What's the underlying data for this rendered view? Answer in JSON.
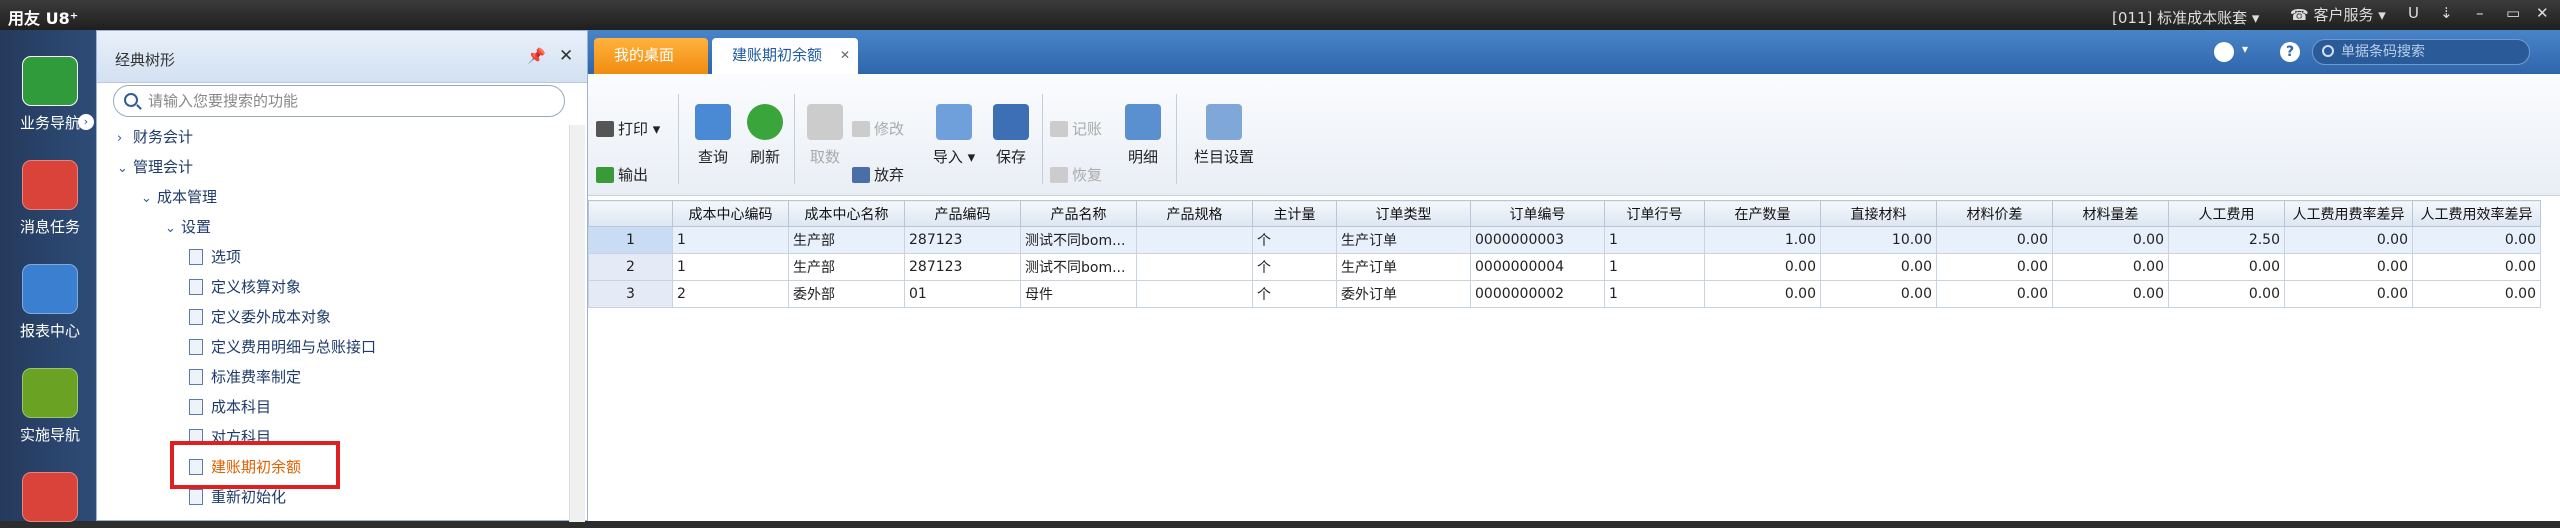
{
  "titlebar": {
    "app_title": "用友 U8⁺",
    "account": "[011] 标准成本账套",
    "service": "客户服务",
    "controls": [
      "U",
      "⇣",
      "–",
      "▭",
      "✕"
    ]
  },
  "leftnav": [
    {
      "label": "业务导航",
      "icon": "business-nav-icon",
      "color": "#2f9b3a"
    },
    {
      "label": "消息任务",
      "icon": "message-icon",
      "color": "#d9433a"
    },
    {
      "label": "报表中心",
      "icon": "report-icon",
      "color": "#3b7fd0"
    },
    {
      "label": "实施导航",
      "icon": "implement-icon",
      "color": "#6aa224"
    },
    {
      "label": "",
      "icon": "more-app-icon",
      "color": "#d9433a"
    }
  ],
  "tree": {
    "title": "经典树形",
    "search_placeholder": "请输入您要搜索的功能",
    "nodes": [
      {
        "label": "财务会计",
        "level": 0,
        "type": "collapsed"
      },
      {
        "label": "管理会计",
        "level": 0,
        "type": "expanded"
      },
      {
        "label": "成本管理",
        "level": 1,
        "type": "expanded"
      },
      {
        "label": "设置",
        "level": 2,
        "type": "expanded"
      },
      {
        "label": "选项",
        "level": 3,
        "type": "leaf"
      },
      {
        "label": "定义核算对象",
        "level": 3,
        "type": "leaf"
      },
      {
        "label": "定义委外成本对象",
        "level": 3,
        "type": "leaf"
      },
      {
        "label": "定义费用明细与总账接口",
        "level": 3,
        "type": "leaf"
      },
      {
        "label": "标准费率制定",
        "level": 3,
        "type": "leaf"
      },
      {
        "label": "成本科目",
        "level": 3,
        "type": "leaf"
      },
      {
        "label": "对方科目",
        "level": 3,
        "type": "leaf"
      },
      {
        "label": "建账期初余额",
        "level": 3,
        "type": "leaf",
        "active": true
      },
      {
        "label": "重新初始化",
        "level": 3,
        "type": "leaf"
      }
    ]
  },
  "tabs": {
    "desktop": "我的桌面",
    "balance": "建账期初余额",
    "close": "✕"
  },
  "barcode_placeholder": "单据条码搜索",
  "help": "?",
  "toolbar": {
    "print": "打印",
    "export": "输出",
    "query": "查询",
    "refresh": "刷新",
    "fetch": "取数",
    "modify": "修改",
    "abandon": "放弃",
    "import": "导入",
    "save": "保存",
    "post": "记账",
    "restore": "恢复",
    "detail": "明细",
    "column_settings": "栏目设置"
  },
  "table": {
    "columns": [
      "",
      "成本中心编码",
      "成本中心名称",
      "产品编码",
      "产品名称",
      "产品规格",
      "主计量",
      "订单类型",
      "订单编号",
      "订单行号",
      "在产数量",
      "直接材料",
      "材料价差",
      "材料量差",
      "人工费用",
      "人工费用费率差异",
      "人工费用效率差异"
    ],
    "rows": [
      [
        "1",
        "1",
        "生产部",
        "287123",
        "测试不同bom...",
        "",
        "个",
        "生产订单",
        "0000000003",
        "1",
        "1.00",
        "10.00",
        "0.00",
        "0.00",
        "2.50",
        "0.00",
        "0.00"
      ],
      [
        "2",
        "1",
        "生产部",
        "287123",
        "测试不同bom...",
        "",
        "个",
        "生产订单",
        "0000000004",
        "1",
        "0.00",
        "0.00",
        "0.00",
        "0.00",
        "0.00",
        "0.00",
        "0.00"
      ],
      [
        "3",
        "2",
        "委外部",
        "01",
        "母件",
        "",
        "个",
        "委外订单",
        "0000000002",
        "1",
        "0.00",
        "0.00",
        "0.00",
        "0.00",
        "0.00",
        "0.00",
        "0.00"
      ]
    ]
  }
}
